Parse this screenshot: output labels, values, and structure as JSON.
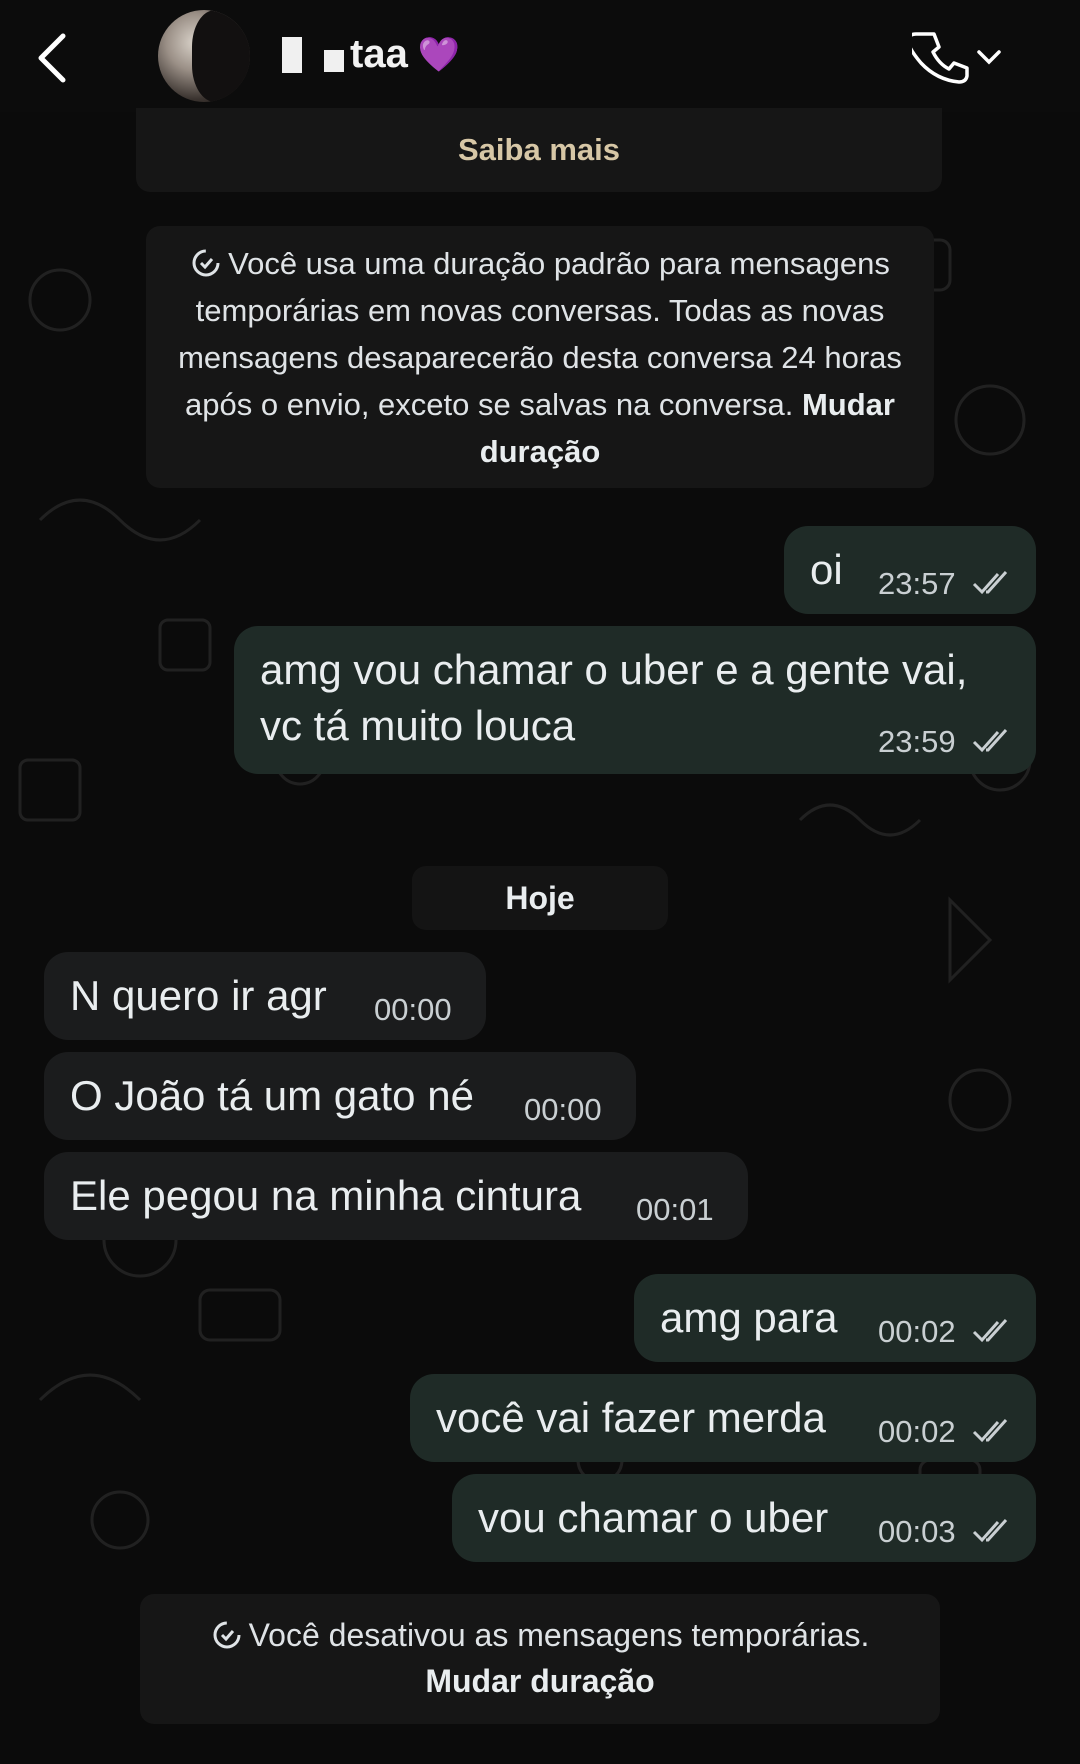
{
  "header": {
    "contact_name": "taa",
    "heart_glyph": "💜"
  },
  "banner": {
    "link": "Saiba mais"
  },
  "system_notice_top": {
    "text": "Você usa uma duração padrão para mensagens temporárias em novas conversas. Todas as novas mensagens desaparecerão desta conversa 24 horas após o envio, exceto se salvas na conversa.",
    "link": "Mudar duração"
  },
  "messages": [
    {
      "direction": "out",
      "text": "oi",
      "time": "23:57",
      "status": "read"
    },
    {
      "direction": "out",
      "text": "amg vou chamar o uber e a gente vai,",
      "text2": "vc tá muito louca",
      "time": "23:59",
      "status": "read"
    },
    {
      "direction": "in",
      "text": "N quero ir agr",
      "time": "00:00"
    },
    {
      "direction": "in",
      "text": "O João tá um gato né",
      "time": "00:00"
    },
    {
      "direction": "in",
      "text": "Ele pegou na minha cintura",
      "time": "00:01"
    },
    {
      "direction": "out",
      "text": "amg para",
      "time": "00:02",
      "status": "read"
    },
    {
      "direction": "out",
      "text": "você vai fazer merda",
      "time": "00:02",
      "status": "read"
    },
    {
      "direction": "out",
      "text": "vou chamar o uber",
      "time": "00:03",
      "status": "read"
    }
  ],
  "date_divider": "Hoje",
  "system_notice_bottom": {
    "text": "Você desativou as mensagens temporárias.",
    "link": "Mudar duração"
  },
  "colors": {
    "background": "#0b0b0b",
    "outgoing_bubble": "#1f2b27",
    "incoming_bubble": "#1b1c1d",
    "system_bubble": "#161616",
    "banner_link": "#d7c7a6"
  },
  "icons": {
    "back": "chevron-left-icon",
    "call": "phone-icon",
    "call_menu": "chevron-down-icon",
    "timer": "disappearing-timer-icon",
    "read_receipt": "double-check-icon"
  }
}
